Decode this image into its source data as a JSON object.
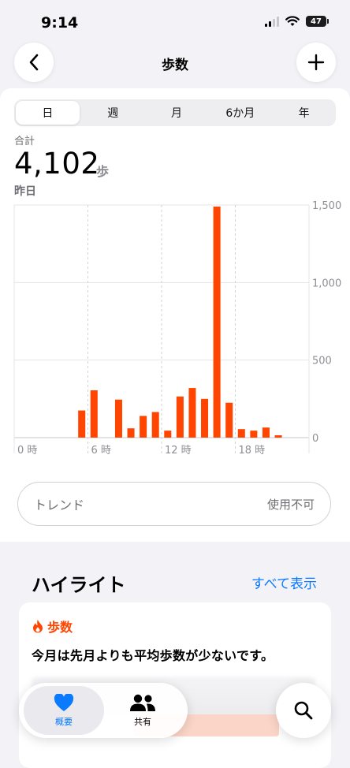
{
  "status_bar": {
    "time": "9:14",
    "battery": "47"
  },
  "nav": {
    "title": "歩数",
    "back_icon": "chevron-left-icon",
    "add_icon": "plus-icon"
  },
  "segments": [
    {
      "label": "日",
      "active": true
    },
    {
      "label": "週",
      "active": false
    },
    {
      "label": "月",
      "active": false
    },
    {
      "label": "6か月",
      "active": false
    },
    {
      "label": "年",
      "active": false
    }
  ],
  "summary": {
    "label": "合計",
    "value": "4,102",
    "unit": "歩",
    "date": "昨日"
  },
  "chart_data": {
    "type": "bar",
    "x_tick_labels": [
      "0 時",
      "6 時",
      "12 時",
      "18 時"
    ],
    "y_tick_labels": [
      "0",
      "500",
      "1,000",
      "1,500"
    ],
    "ylim": [
      0,
      1500
    ],
    "bar_color": "#ff4500",
    "hours": [
      5,
      6,
      8,
      9,
      10,
      11,
      12,
      13,
      14,
      15,
      16,
      17,
      18,
      19,
      20,
      21
    ],
    "values": [
      175,
      305,
      245,
      60,
      140,
      165,
      45,
      265,
      320,
      250,
      1490,
      225,
      55,
      45,
      65,
      15
    ]
  },
  "trend": {
    "label": "トレンド",
    "status": "使用不可"
  },
  "highlights": {
    "title": "ハイライト",
    "show_all": "すべて表示",
    "card": {
      "category": "歩数",
      "icon": "flame-icon",
      "text": "今月は先月よりも平均歩数が少ないです。"
    }
  },
  "tabbar": {
    "tabs": [
      {
        "label": "概要",
        "icon": "heart-icon",
        "active": true
      },
      {
        "label": "共有",
        "icon": "people-icon",
        "active": false
      }
    ],
    "search_icon": "search-icon"
  },
  "colors": {
    "accent": "#ff4500",
    "link": "#0a7aff"
  }
}
